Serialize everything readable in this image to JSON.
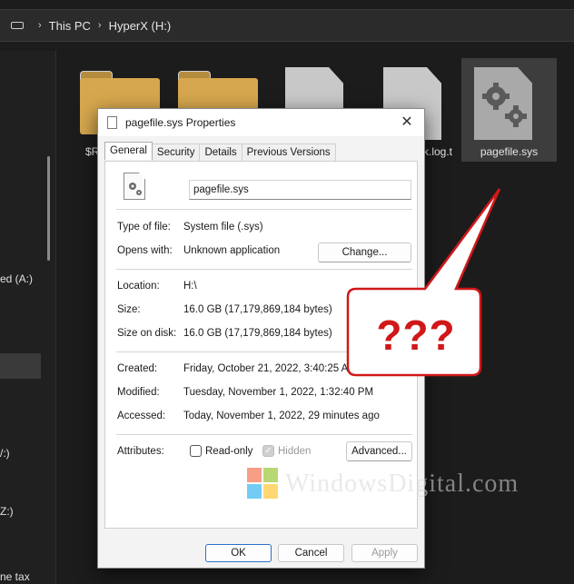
{
  "explorer": {
    "breadcrumb": [
      "This PC",
      "HyperX (H:)"
    ],
    "sep": "›",
    "nav_labels": [
      "ed (A:)",
      "/:)",
      "Z:)",
      "ne tax"
    ],
    "files": [
      {
        "name": "$R",
        "kind": "folder"
      },
      {
        "name": "",
        "kind": "folder"
      },
      {
        "name": "",
        "kind": "file"
      },
      {
        "name": "k.log.t",
        "kind": "file"
      },
      {
        "name": "pagefile.sys",
        "kind": "system-file",
        "selected": true
      }
    ]
  },
  "dialog": {
    "title": "pagefile.sys Properties",
    "close": "✕",
    "tabs": [
      "General",
      "Security",
      "Details",
      "Previous Versions"
    ],
    "active_tab": "General",
    "file_name": "pagefile.sys",
    "type_label": "Type of file:",
    "type_value": "System file (.sys)",
    "opens_label": "Opens with:",
    "opens_value": "Unknown application",
    "change_button": "Change...",
    "location_label": "Location:",
    "location_value": "H:\\",
    "size_label": "Size:",
    "size_value": "16.0 GB (17,179,869,184 bytes)",
    "size_disk_label": "Size on disk:",
    "size_disk_value": "16.0 GB (17,179,869,184 bytes)",
    "created_label": "Created:",
    "created_value": "Friday, October 21, 2022, 3:40:25 AM",
    "modified_label": "Modified:",
    "modified_value": "Tuesday, November 1, 2022, 1:32:40 PM",
    "accessed_label": "Accessed:",
    "accessed_value": "Today, November 1, 2022, 29 minutes ago",
    "attributes_label": "Attributes:",
    "readonly_label": "Read-only",
    "readonly_checked": false,
    "hidden_label": "Hidden",
    "hidden_checked": true,
    "advanced_button": "Advanced...",
    "ok_button": "OK",
    "cancel_button": "Cancel",
    "apply_button": "Apply"
  },
  "callout": {
    "text": "???",
    "color": "#d01818"
  },
  "watermark": {
    "text": "WindowsDigital.com"
  }
}
